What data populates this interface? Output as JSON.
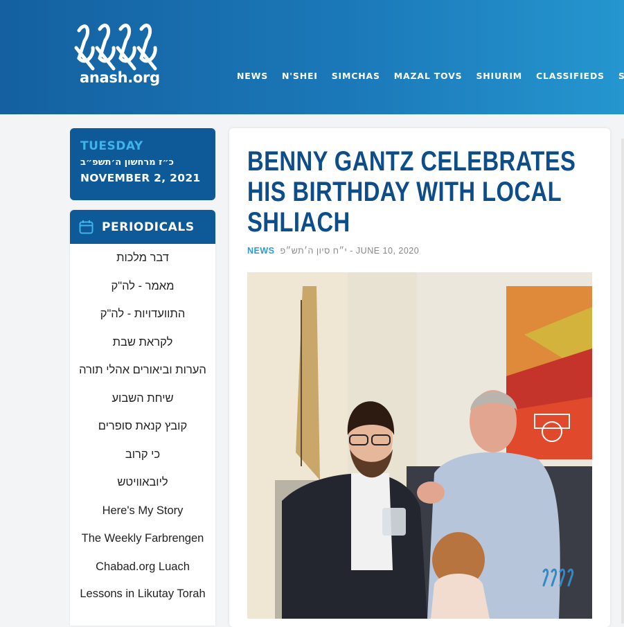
{
  "site": {
    "logo_text": "anash.org"
  },
  "nav": {
    "items": [
      "NEWS",
      "N'SHEI",
      "SIMCHAS",
      "MAZAL TOVS",
      "SHIURIM",
      "CLASSIFIEDS",
      "SUBS"
    ]
  },
  "date": {
    "day": "TUESDAY",
    "hebrew": "כ״ז מרחשון ה׳תשפ״ב",
    "english": "NOVEMBER 2, 2021"
  },
  "periodicals": {
    "title": "PERIODICALS",
    "items": [
      "דבר מלכות",
      "מאמר - לה\"ק",
      "התוועדויות - לה\"ק",
      "לקראת שבת",
      "הערות וביאורים אהלי תורה",
      "שיחת השבוע",
      "קובץ קנאת סופרים",
      "כי קרוב",
      "ליובאוויטש",
      "Here's My Story",
      "The Weekly Farbrengen",
      "Chabad.org Luach",
      "Lessons in Likutay Torah"
    ]
  },
  "article": {
    "headline": "BENNY GANTZ CELEBRATES HIS BIRTHDAY WITH LOCAL SHLIACH",
    "category": "NEWS",
    "date": "י״ח סיון ה׳תש״פ - JUNE 10, 2020",
    "watermark": "anash.org"
  },
  "colors": {
    "header_start": "#1460a0",
    "header_end": "#2596cf",
    "box": "#0e5a99",
    "accent": "#3fb4ea",
    "headline": "#0d4d8a"
  }
}
